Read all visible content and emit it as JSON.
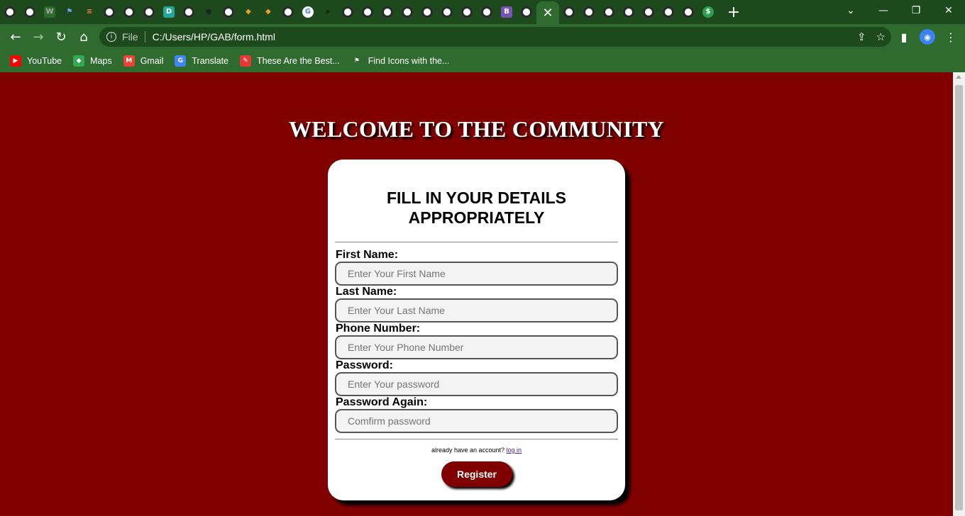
{
  "browser": {
    "tabs": [
      {
        "icon": "globe-icon"
      },
      {
        "icon": "globe-icon"
      },
      {
        "icon": "w-logo-icon",
        "glyph": "W"
      },
      {
        "icon": "flag-icon",
        "glyph": "⚑"
      },
      {
        "icon": "stackoverflow-icon",
        "glyph": "≡"
      },
      {
        "icon": "globe-icon"
      },
      {
        "icon": "globe-icon"
      },
      {
        "icon": "globe-icon"
      },
      {
        "icon": "d-app-icon",
        "glyph": "D"
      },
      {
        "icon": "globe-icon"
      },
      {
        "icon": "github-icon",
        "glyph": "●"
      },
      {
        "icon": "globe-icon"
      },
      {
        "icon": "diamond-icon",
        "glyph": "◆"
      },
      {
        "icon": "diamond-icon",
        "glyph": "◆"
      },
      {
        "icon": "globe-icon"
      },
      {
        "icon": "google-icon",
        "glyph": "G"
      },
      {
        "icon": "search-icon",
        "glyph": "⌕"
      },
      {
        "icon": "globe-icon"
      },
      {
        "icon": "globe-icon"
      },
      {
        "icon": "globe-icon"
      },
      {
        "icon": "globe-icon"
      },
      {
        "icon": "globe-icon"
      },
      {
        "icon": "globe-icon"
      },
      {
        "icon": "globe-icon"
      },
      {
        "icon": "globe-icon"
      },
      {
        "icon": "bootstrap-icon",
        "glyph": "B"
      },
      {
        "icon": "globe-icon"
      }
    ],
    "active_tab_close": "✕",
    "tabs_after": [
      {
        "icon": "globe-icon"
      },
      {
        "icon": "globe-icon"
      },
      {
        "icon": "globe-icon"
      },
      {
        "icon": "globe-icon"
      },
      {
        "icon": "globe-icon"
      },
      {
        "icon": "globe-icon"
      },
      {
        "icon": "globe-icon"
      },
      {
        "icon": "money-icon",
        "glyph": "$"
      }
    ],
    "new_tab": "+",
    "window_controls": {
      "dropdown": "⌄",
      "minimize": "—",
      "restore": "❐",
      "close": "✕"
    },
    "nav": {
      "back": "←",
      "forward": "→",
      "reload": "↻",
      "home": "⌂"
    },
    "address": {
      "info": "i",
      "scheme": "File",
      "url": "C:/Users/HP/GAB/form.html"
    },
    "address_icons": {
      "share": "⇪",
      "star": "☆"
    },
    "toolbar_icons": {
      "sidepanel": "▮",
      "profile": "◉",
      "menu": "⋮"
    },
    "bookmarks": [
      {
        "label": "YouTube",
        "icon": "youtube-icon",
        "glyph": "▶",
        "color": "#ff0000"
      },
      {
        "label": "Maps",
        "icon": "maps-icon",
        "glyph": "◆",
        "color": "#34a853"
      },
      {
        "label": "Gmail",
        "icon": "gmail-icon",
        "glyph": "M",
        "color": "#ea4335"
      },
      {
        "label": "Translate",
        "icon": "translate-icon",
        "glyph": "G",
        "color": "#4285f4"
      },
      {
        "label": "These Are the Best...",
        "icon": "pen-icon",
        "glyph": "✎",
        "color": "#e53935"
      },
      {
        "label": "Find Icons with the...",
        "icon": "flag-icon",
        "glyph": "⚑",
        "color": "#2f6a2f"
      }
    ]
  },
  "page": {
    "heading": "WELCOME TO THE COMMUNITY",
    "form": {
      "title_line1": "FILL IN YOUR DETAILS",
      "title_line2": "APPROPRIATELY",
      "fields": [
        {
          "label": "First Name:",
          "placeholder": "Enter Your First Name"
        },
        {
          "label": "Last Name:",
          "placeholder": "Enter Your Last Name"
        },
        {
          "label": "Phone Number:",
          "placeholder": "Enter Your Phone Number"
        },
        {
          "label": "Password:",
          "placeholder": "Enter Your password"
        },
        {
          "label": "Password Again:",
          "placeholder": "Comfirm password"
        }
      ],
      "login_prompt": "already have an account?",
      "login_link": "log in",
      "register_button": "Register"
    },
    "colors": {
      "background": "#800000",
      "chrome": "#2f6a2f",
      "card": "#ffffff"
    }
  }
}
